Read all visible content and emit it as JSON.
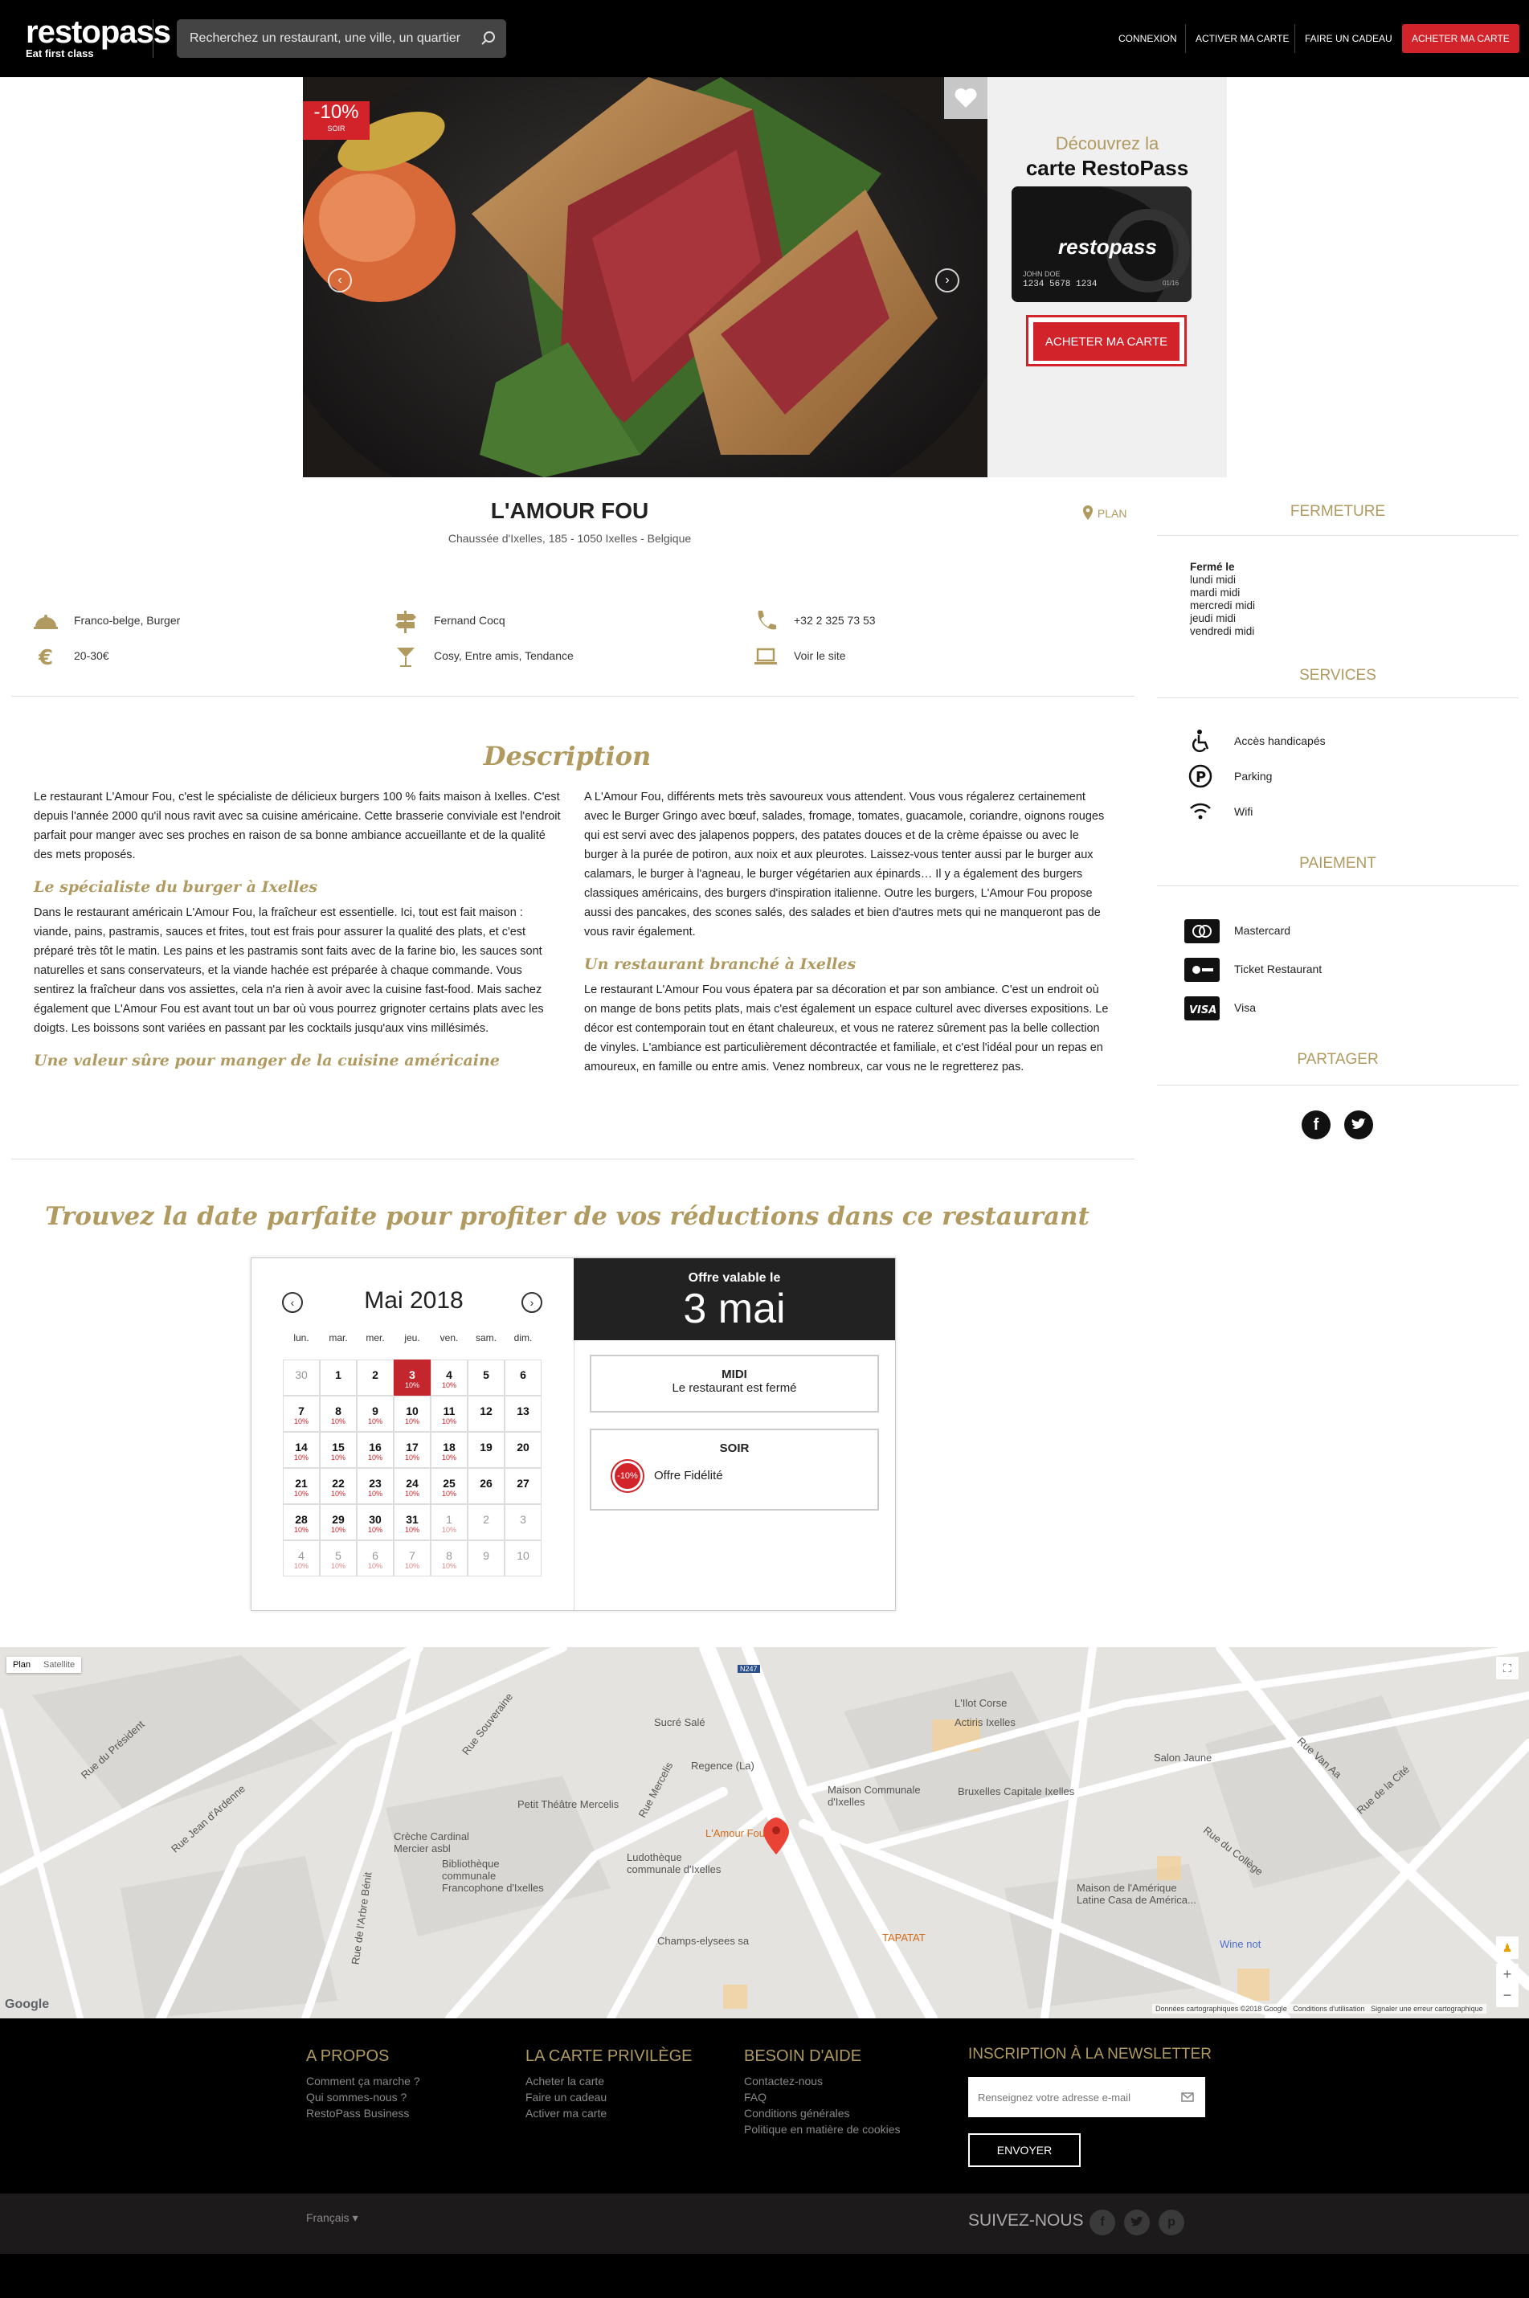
{
  "header": {
    "logo_word": "restopass",
    "logo_tagline": "Eat first class",
    "search_placeholder": "Recherchez un restaurant, une ville, un quartier",
    "nav": [
      "CONNEXION",
      "ACTIVER MA CARTE",
      "FAIRE UN CADEAU",
      "ACHETER MA CARTE"
    ]
  },
  "hero": {
    "discount": "-10%",
    "discount_period": "SOIR",
    "promo_line1": "Découvrez la",
    "promo_line2": "carte RestoPass",
    "card_brand": "restopass",
    "card_number": "1234 5678 1234",
    "card_holder": "JOHN DOE",
    "card_expiry": "01/16",
    "buy_button": "ACHETER MA CARTE"
  },
  "restaurant": {
    "name": "L'AMOUR FOU",
    "address": "Chaussée d'Ixelles, 185 - 1050 Ixelles - Belgique",
    "plan_link": "PLAN",
    "cuisine": "Franco-belge, Burger",
    "price": "20-30€",
    "metro": "Fernand Cocq",
    "ambiance": "Cosy, Entre amis, Tendance",
    "phone": "+32 2 325 73 53",
    "website": "Voir le site"
  },
  "description": {
    "title": "Description",
    "left": {
      "p1": "Le restaurant L'Amour Fou, c'est le spécialiste de délicieux burgers 100 % faits maison à Ixelles. C'est depuis l'année 2000 qu'il nous ravit avec sa cuisine américaine. Cette brasserie conviviale est l'endroit parfait pour manger avec ses proches en raison de sa bonne ambiance accueillante et de la qualité des mets proposés.",
      "h1": "Le spécialiste du burger à Ixelles",
      "p2": "Dans le restaurant américain L'Amour Fou, la fraîcheur est essentielle. Ici, tout est fait maison : viande, pains, pastramis, sauces et frites, tout est frais pour assurer la qualité des plats, et c'est préparé très tôt le matin. Les pains et les pastramis sont faits avec de la farine bio, les sauces sont naturelles et sans conservateurs, et la viande hachée est préparée à chaque commande. Vous sentirez la fraîcheur dans vos assiettes, cela n'a rien à avoir avec la cuisine fast-food. Mais sachez également que L'Amour Fou est avant tout un bar où vous pourrez grignoter certains plats avec les doigts. Les boissons sont variées en passant par les cocktails jusqu'aux vins millésimés.",
      "h2": "Une valeur sûre pour manger de la cuisine américaine"
    },
    "right": {
      "p1": "A L'Amour Fou, différents mets très savoureux vous attendent. Vous vous régalerez certainement avec le Burger Gringo avec bœuf, salades, fromage, tomates, guacamole, coriandre, oignons rouges qui est servi avec des jalapenos poppers, des patates douces et de la crème épaisse ou avec le burger à la purée de potiron, aux noix et aux pleurotes. Laissez-vous tenter aussi par le burger aux calamars, le burger à l'agneau, le burger végétarien aux épinards… Il y a également des burgers classiques américains, des burgers d'inspiration italienne. Outre les burgers, L'Amour Fou propose aussi des pancakes, des scones salés, des salades et bien d'autres mets qui ne manqueront pas de vous ravir également.",
      "h1": "Un restaurant branché à Ixelles",
      "p2": "Le restaurant L'Amour Fou vous épatera par sa décoration et par son ambiance. C'est un endroit où on mange de bons petits plats, mais c'est également un espace culturel avec diverses expositions. Le décor est contemporain tout en étant chaleureux, et vous ne raterez sûrement pas la belle collection de vinyles. L'ambiance est particulièrement décontractée et familiale, et c'est l'idéal pour un repas en amoureux, en famille ou entre amis. Venez nombreux, car vous ne le regretterez pas."
    }
  },
  "sidebar": {
    "closing_title": "FERMETURE",
    "closed_label": "Fermé le",
    "closed_days": [
      "lundi midi",
      "mardi midi",
      "mercredi midi",
      "jeudi midi",
      "vendredi midi"
    ],
    "services_title": "SERVICES",
    "services": [
      "Accès handicapés",
      "Parking",
      "Wifi"
    ],
    "payment_title": "PAIEMENT",
    "payments": [
      "Mastercard",
      "Ticket Restaurant",
      "Visa"
    ],
    "share_title": "PARTAGER"
  },
  "calendar": {
    "title": "Trouvez la date parfaite pour profiter de vos réductions dans ce restaurant",
    "month": "Mai 2018",
    "weekdays": [
      "lun.",
      "mar.",
      "mer.",
      "jeu.",
      "ven.",
      "sam.",
      "dim."
    ],
    "days": [
      [
        "30",
        "",
        true
      ],
      [
        "1",
        "",
        false
      ],
      [
        "2",
        "",
        false
      ],
      [
        "3",
        "10%",
        false,
        true
      ],
      [
        "4",
        "10%",
        false
      ],
      [
        "5",
        "",
        false
      ],
      [
        "6",
        "",
        false
      ],
      [
        "7",
        "10%",
        false
      ],
      [
        "8",
        "10%",
        false
      ],
      [
        "9",
        "10%",
        false
      ],
      [
        "10",
        "10%",
        false
      ],
      [
        "11",
        "10%",
        false
      ],
      [
        "12",
        "",
        false
      ],
      [
        "13",
        "",
        false
      ],
      [
        "14",
        "10%",
        false
      ],
      [
        "15",
        "10%",
        false
      ],
      [
        "16",
        "10%",
        false
      ],
      [
        "17",
        "10%",
        false
      ],
      [
        "18",
        "10%",
        false
      ],
      [
        "19",
        "",
        false
      ],
      [
        "20",
        "",
        false
      ],
      [
        "21",
        "10%",
        false
      ],
      [
        "22",
        "10%",
        false
      ],
      [
        "23",
        "10%",
        false
      ],
      [
        "24",
        "10%",
        false
      ],
      [
        "25",
        "10%",
        false
      ],
      [
        "26",
        "",
        false
      ],
      [
        "27",
        "",
        false
      ],
      [
        "28",
        "10%",
        false
      ],
      [
        "29",
        "10%",
        false
      ],
      [
        "30",
        "10%",
        false
      ],
      [
        "31",
        "10%",
        false
      ],
      [
        "1",
        "10%",
        true
      ],
      [
        "2",
        "",
        true
      ],
      [
        "3",
        "",
        true
      ],
      [
        "4",
        "10%",
        true
      ],
      [
        "5",
        "10%",
        true
      ],
      [
        "6",
        "10%",
        true
      ],
      [
        "7",
        "10%",
        true
      ],
      [
        "8",
        "10%",
        true
      ],
      [
        "9",
        "",
        true
      ],
      [
        "10",
        "",
        true
      ]
    ],
    "offer_label": "Offre valable le",
    "offer_date": "3 mai",
    "midi_title": "MIDI",
    "midi_text": "Le restaurant est fermé",
    "soir_title": "SOIR",
    "soir_badge": "-10%",
    "soir_text": "Offre Fidélité"
  },
  "map": {
    "btn_plan": "Plan",
    "btn_satellite": "Satellite",
    "labels": [
      "L'Ilot Corse",
      "Actiris Ixelles",
      "Sucré Salé",
      "Regence (La)",
      "Maison Communale d'Ixelles",
      "Bruxelles Capitale Ixelles",
      "Salon Jaune",
      "Petit Théâtre Mercelis",
      "L'Amour Fou",
      "Crèche Cardinal Mercier asbl",
      "Bibliothèque communale Francophone d'Ixelles",
      "Ludothèque communale d'Ixelles",
      "Maison de l'Amérique Latine Casa de América...",
      "Champs-elysees sa",
      "TAPATAT",
      "Wine not",
      "Rue Souveraine",
      "Rue de l'Arbre Bénit",
      "Rue Mercelis",
      "Rue du Collège",
      "Rue Van Aa",
      "Rue de la Cité",
      "Rue Jean d'Ardenne",
      "Rue du Président",
      "N247"
    ],
    "copyright": "Données cartographiques ©2018 Google",
    "terms": "Conditions d'utilisation",
    "report": "Signaler une erreur cartographique",
    "google": "Google"
  },
  "footer": {
    "col1_title": "A PROPOS",
    "col1": [
      "Comment ça marche ?",
      "Qui sommes-nous ?",
      "RestoPass Business"
    ],
    "col2_title": "LA CARTE PRIVILÈGE",
    "col2": [
      "Acheter la carte",
      "Faire un cadeau",
      "Activer ma carte"
    ],
    "col3_title": "BESOIN D'AIDE",
    "col3": [
      "Contactez-nous",
      "FAQ",
      "Conditions générales",
      "Politique en matière de cookies"
    ],
    "newsletter_title": "INSCRIPTION À LA NEWSLETTER",
    "newsletter_placeholder": "Renseignez votre adresse e-mail",
    "send": "ENVOYER",
    "language": "Français",
    "follow": "SUIVEZ-NOUS"
  },
  "colors": {
    "accent": "#b09a60",
    "red": "#d2232a",
    "header": "#000000"
  }
}
